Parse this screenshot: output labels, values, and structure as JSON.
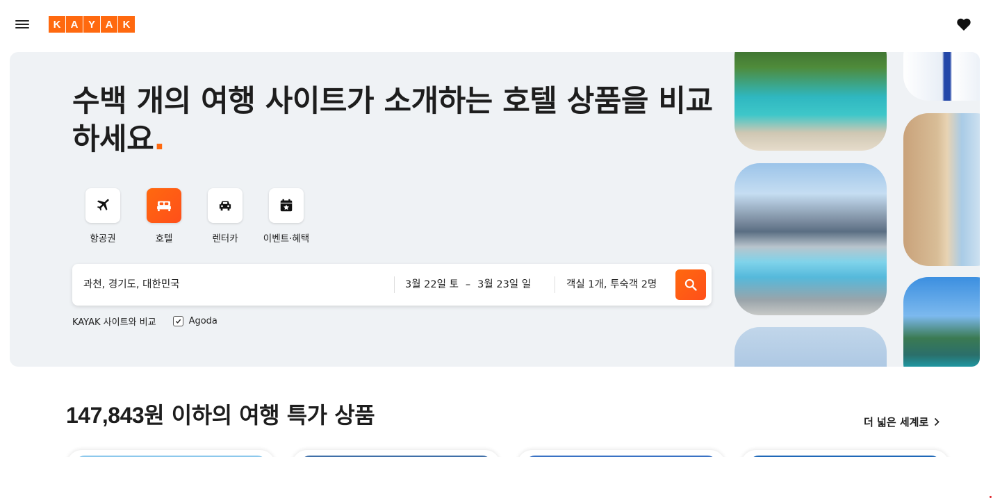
{
  "header": {
    "logo_letters": [
      "K",
      "A",
      "Y",
      "A",
      "K"
    ],
    "menu_icon": "hamburger-menu-icon",
    "heart_icon": "heart-icon"
  },
  "hero": {
    "title_main": "수백 개의 여행 사이트가 소개하는 호텔 상품을 비교하세요",
    "title_dot": ".",
    "verticals": [
      {
        "label": "항공권",
        "icon": "airplane-icon",
        "active": false
      },
      {
        "label": "호텔",
        "icon": "bed-icon",
        "active": true
      },
      {
        "label": "렌터카",
        "icon": "car-icon",
        "active": false
      },
      {
        "label": "이벤트·혜택",
        "icon": "calendar-star-icon",
        "active": false
      }
    ],
    "search": {
      "location": "과천, 경기도, 대한민국",
      "checkin": "3월 22일 토",
      "date_separator": "–",
      "checkout": "3월 23일 일",
      "guests": "객실 1개, 투숙객 2명",
      "search_icon": "search-icon"
    },
    "compare": {
      "label": "KAYAK 사이트와 비교",
      "partner": "Agoda",
      "partner_checked": true
    }
  },
  "deals": {
    "price": "147,843",
    "title_rest": "원 이하의 여행 특가 상품",
    "explore_label": "더 넓은 세계로"
  },
  "colors": {
    "brand": "#ff690f",
    "hero_bg": "#eff2f5"
  }
}
